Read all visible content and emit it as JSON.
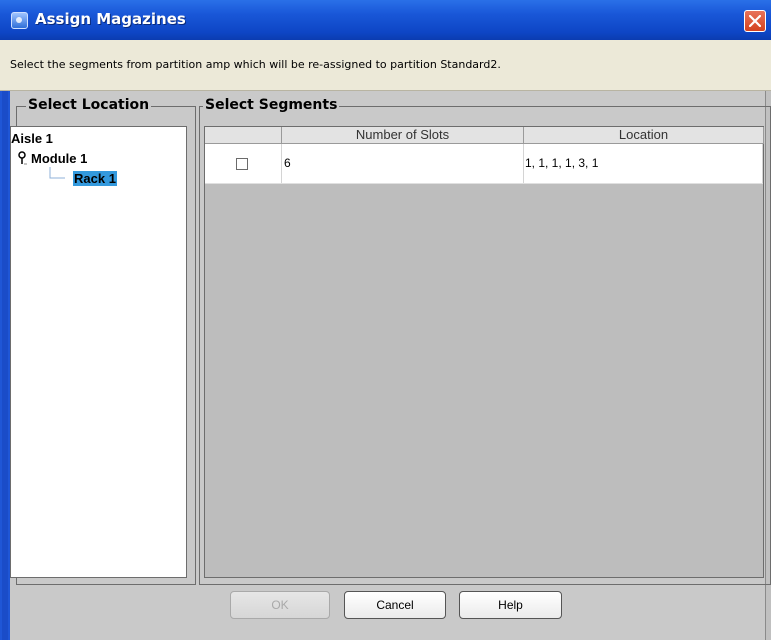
{
  "window": {
    "title": "Assign Magazines"
  },
  "instruction": "Select the segments from partition amp which will be re-assigned to partition Standard2.",
  "location_panel": {
    "legend": "Select Location",
    "tree": [
      {
        "label": "Aisle 1",
        "level": 0,
        "selected": false
      },
      {
        "label": "Module 1",
        "level": 1,
        "selected": false
      },
      {
        "label": "Rack 1",
        "level": 2,
        "selected": true
      }
    ]
  },
  "segments_panel": {
    "legend": "Select Segments",
    "columns": [
      "",
      "Number of Slots",
      "Location"
    ],
    "rows": [
      {
        "checked": false,
        "slots": "6",
        "location": "1, 1, 1, 1, 3, 1"
      }
    ]
  },
  "buttons": {
    "ok": "OK",
    "cancel": "Cancel",
    "help": "Help"
  },
  "colors": {
    "titlebar": "#0e46c6",
    "selection": "#3399dd",
    "panel_bg": "#c9c9c9"
  }
}
